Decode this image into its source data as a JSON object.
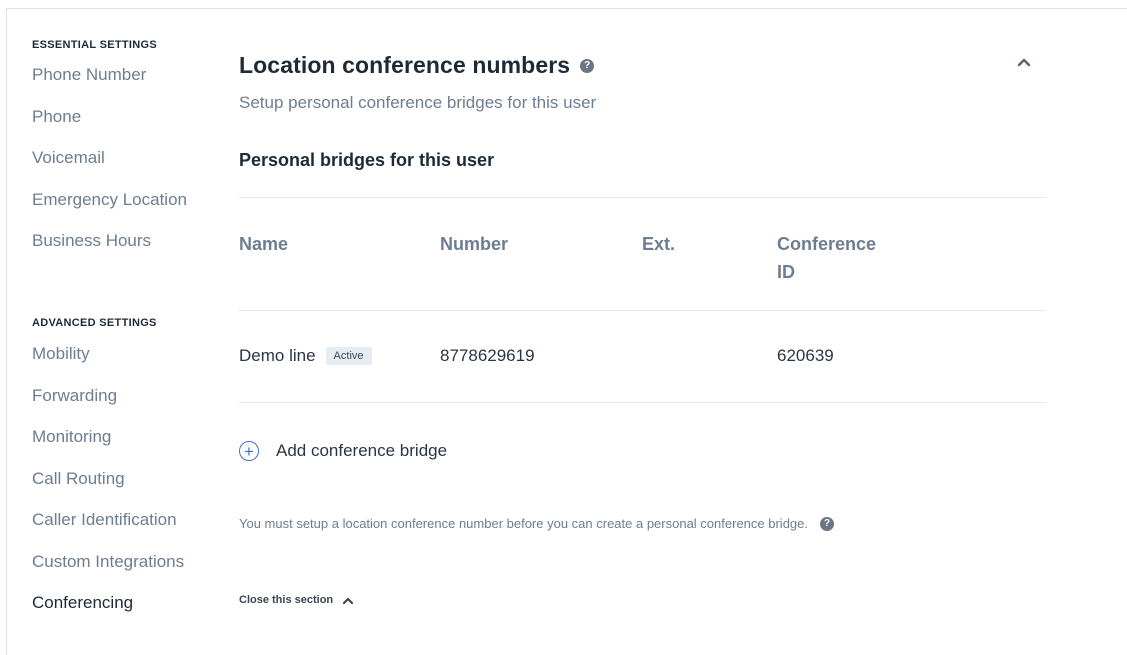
{
  "sidebar": {
    "essential_heading": "ESSENTIAL SETTINGS",
    "essential_items": [
      {
        "label": "Phone Number"
      },
      {
        "label": "Phone"
      },
      {
        "label": "Voicemail"
      },
      {
        "label": "Emergency Location"
      },
      {
        "label": "Business Hours"
      }
    ],
    "advanced_heading": "ADVANCED SETTINGS",
    "advanced_items": [
      {
        "label": "Mobility"
      },
      {
        "label": "Forwarding"
      },
      {
        "label": "Monitoring"
      },
      {
        "label": "Call Routing"
      },
      {
        "label": "Caller Identification"
      },
      {
        "label": "Custom Integrations"
      },
      {
        "label": "Conferencing",
        "active": true
      }
    ]
  },
  "section": {
    "title": "Location conference numbers",
    "help_icon": "?",
    "subtitle": "Setup personal conference bridges for this user",
    "bridges_heading": "Personal bridges for this user",
    "table": {
      "headers": {
        "name": "Name",
        "number": "Number",
        "ext": "Ext.",
        "conference_id_line1": "Conference",
        "conference_id_line2": "ID"
      },
      "rows": [
        {
          "name": "Demo line",
          "status": "Active",
          "number": "8778629619",
          "ext": "",
          "conference_id": "620639"
        }
      ]
    },
    "add_icon": "+",
    "add_label": "Add conference bridge",
    "note": "You must setup a location conference number before you can create a personal conference bridge.",
    "close_label": "Close this section"
  },
  "colors": {
    "accent": "#3d6fd6",
    "text_dark": "#1e2a37",
    "text_muted": "#6d7d92",
    "badge_bg": "#e6ecf3"
  }
}
